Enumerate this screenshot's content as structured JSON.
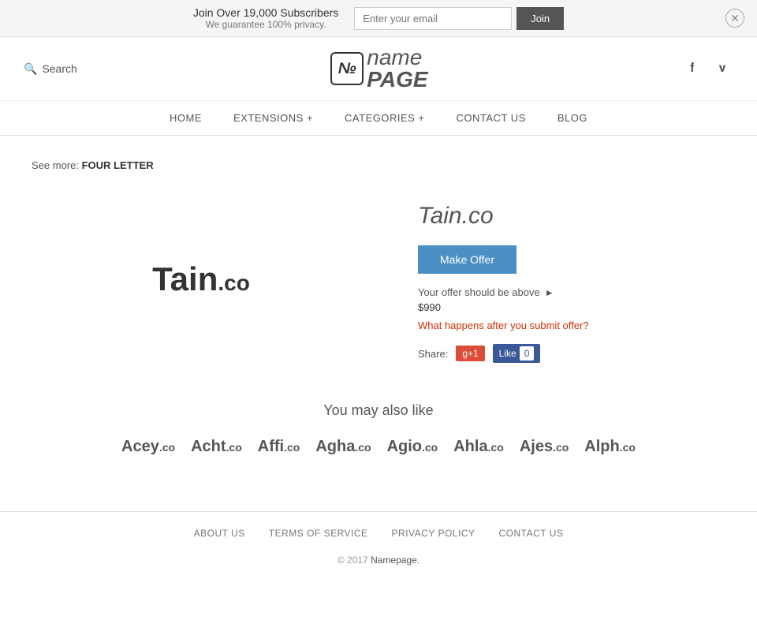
{
  "banner": {
    "main_text": "Join Over 19,000 Subscribers",
    "sub_text": "We guarantee 100% privacy.",
    "email_placeholder": "Enter your email",
    "join_label": "Join"
  },
  "header": {
    "search_label": "Search",
    "logo_icon": "n",
    "logo_name": "name",
    "logo_page": "PAGE",
    "facebook_icon": "f",
    "twitter_icon": "t"
  },
  "nav": {
    "items": [
      {
        "label": "HOME"
      },
      {
        "label": "EXTENSIONS +"
      },
      {
        "label": "CATEGORIES +"
      },
      {
        "label": "CONTACT US"
      },
      {
        "label": "BLOG"
      }
    ]
  },
  "breadcrumb": {
    "see_more_prefix": "See more:",
    "see_more_link": "FOUR LETTER"
  },
  "domain": {
    "logo_text": "Tain",
    "logo_tld": ".co",
    "display_name": "Tain.co",
    "make_offer_label": "Make Offer",
    "offer_info": "Your offer should be above",
    "offer_amount": "$990",
    "offer_question": "What happens after you submit offer?",
    "share_label": "Share:",
    "gplus_label": "g+1",
    "fb_like_label": "Like",
    "fb_count": "0"
  },
  "also_like": {
    "title": "You may also like",
    "domains": [
      {
        "name": "Acey",
        "tld": ".co"
      },
      {
        "name": "Acht",
        "tld": ".co"
      },
      {
        "name": "Affi",
        "tld": ".co"
      },
      {
        "name": "Agha",
        "tld": ".co"
      },
      {
        "name": "Agio",
        "tld": ".co"
      },
      {
        "name": "Ahla",
        "tld": ".co"
      },
      {
        "name": "Ajes",
        "tld": ".co"
      },
      {
        "name": "Alph",
        "tld": ".co"
      }
    ]
  },
  "footer": {
    "links": [
      {
        "label": "ABOUT US"
      },
      {
        "label": "TERMS OF SERVICE"
      },
      {
        "label": "PRIVACY POLICY"
      },
      {
        "label": "CONTACT US"
      }
    ],
    "copyright": "© 2017",
    "brand_link": "Namepage."
  }
}
